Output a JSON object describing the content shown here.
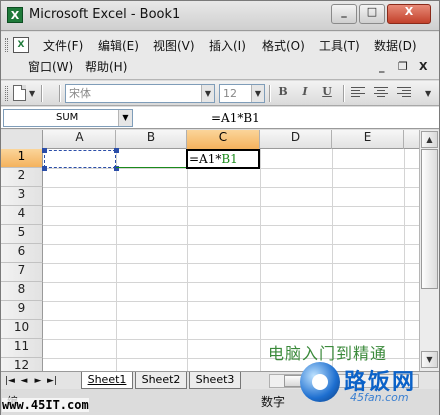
{
  "window": {
    "title": "Microsoft Excel - Book1",
    "app_icon_letter": "X",
    "buttons": {
      "minimize": "_",
      "maximize": "□",
      "close": "X"
    }
  },
  "menubar": {
    "sheet_icon_letter": "X",
    "items": [
      "文件(F)",
      "编辑(E)",
      "视图(V)",
      "插入(I)",
      "格式(O)",
      "工具(T)",
      "数据(D)",
      "窗口(W)",
      "帮助(H)"
    ],
    "mdi_controls": {
      "minimize": "_",
      "restore": "❐",
      "close": "X"
    }
  },
  "toolbar": {
    "font_name": "宋体",
    "font_size": "12",
    "bold": "B",
    "italic": "I",
    "underline": "U"
  },
  "formula_bar": {
    "name_box": "SUM",
    "formula": "=A1*B1"
  },
  "grid": {
    "columns": [
      "A",
      "B",
      "C",
      "D",
      "E"
    ],
    "selected_column": "C",
    "rows": [
      "1",
      "2",
      "3",
      "4",
      "5",
      "6",
      "7",
      "8",
      "9",
      "10",
      "11",
      "12"
    ],
    "selected_row": "1",
    "active_cell": {
      "address": "C1",
      "prefix": "=A1*",
      "ref": "B1"
    }
  },
  "sheet_tabs": {
    "nav": [
      "|◄",
      "◄",
      "►",
      "►|"
    ],
    "tabs": [
      "Sheet1",
      "Sheet2",
      "Sheet3"
    ],
    "active_tab": "Sheet1"
  },
  "statusbar": {
    "left_text": "编",
    "mode_text": "数字"
  },
  "watermark": {
    "url": "www.45IT.com",
    "slogan": "电脑入门到精通",
    "brand": "路饭网",
    "domain": "45fan.com"
  },
  "colors": {
    "selected_header": "#f4b25d",
    "range_a1_border": "#2a4da8",
    "range_b1_color": "#1b8a1b"
  }
}
